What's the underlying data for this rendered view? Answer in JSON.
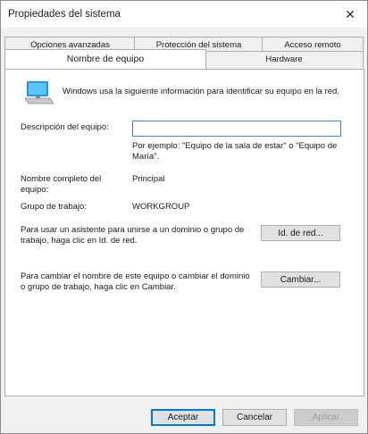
{
  "window": {
    "title": "Propiedades del sistema"
  },
  "tabs_back": [
    {
      "label": "Opciones avanzadas"
    },
    {
      "label": "Protección del sistema"
    },
    {
      "label": "Acceso remoto"
    }
  ],
  "tabs_front": [
    {
      "label": "Nombre de equipo"
    },
    {
      "label": "Hardware"
    }
  ],
  "panel": {
    "intro": "Windows usa la siguiente información para identificar su equipo en la red.",
    "description": {
      "label": "Descripción del equipo:",
      "value": "",
      "hint": "Por ejemplo: \"Equipo de la sala de estar\" o \"Equipo de María\"."
    },
    "full_name": {
      "label": "Nombre completo del equipo:",
      "value": "Principal"
    },
    "workgroup": {
      "label": "Grupo de trabajo:",
      "value": "WORKGROUP"
    },
    "network_id": {
      "text": "Para usar un asistente para unirse a un dominio o grupo de trabajo, haga clic en Id. de red.",
      "button": "Id. de red..."
    },
    "rename": {
      "text": "Para cambiar el nombre de este equipo o cambiar el dominio o grupo de trabajo, haga clic en Cambiar.",
      "button": "Cambiar..."
    }
  },
  "footer": {
    "accept": "Aceptar",
    "cancel": "Cancelar",
    "apply": "Aplicar"
  },
  "icons": {
    "close": "close-icon",
    "computer": "computer-icon"
  },
  "colors": {
    "input_focus": "#3c86d0",
    "primary_border": "#0078d7",
    "monitor": "#1e9be0"
  }
}
